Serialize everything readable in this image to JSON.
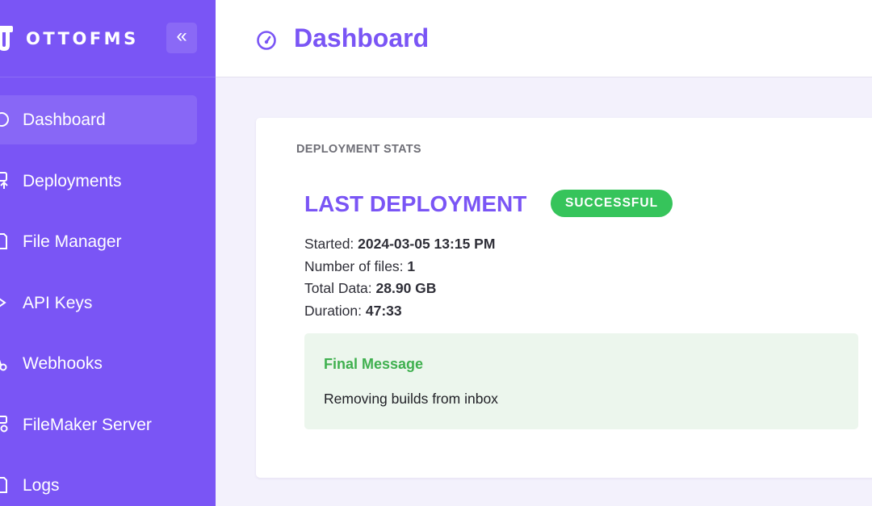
{
  "brand": {
    "name": "OTTOFMS",
    "collapse_label": "«",
    "logo_icon": "ottofms-logo-icon",
    "collapse_icon": "double-chevron-left-icon"
  },
  "sidebar": {
    "items": [
      {
        "label": "Dashboard",
        "icon": "gauge-icon",
        "active": true
      },
      {
        "label": "Deployments",
        "icon": "deploy-icon",
        "active": false
      },
      {
        "label": "File Manager",
        "icon": "folder-icon",
        "active": false
      },
      {
        "label": "API Keys",
        "icon": "key-icon",
        "active": false
      },
      {
        "label": "Webhooks",
        "icon": "webhook-icon",
        "active": false
      },
      {
        "label": "FileMaker Server",
        "icon": "server-icon",
        "active": false
      },
      {
        "label": "Logs",
        "icon": "document-icon",
        "active": false
      }
    ]
  },
  "header": {
    "title": "Dashboard",
    "icon": "gauge-icon"
  },
  "deployment_stats": {
    "heading": "DEPLOYMENT STATS",
    "title": "LAST DEPLOYMENT",
    "status": "SUCCESSFUL",
    "started_label": "Started:",
    "started_value": "2024-03-05 13:15 PM",
    "files_label": "Number of files:",
    "files_value": "1",
    "data_label": "Total Data:",
    "data_value": "28.90 GB",
    "duration_label": "Duration:",
    "duration_value": "47:33",
    "message_title": "Final Message",
    "message_text": "Removing builds from inbox"
  },
  "colors": {
    "brand_purple": "#7a55f5",
    "success_green": "#36c45b",
    "message_bg": "#ecf6ed",
    "message_title": "#3fb04f",
    "page_bg": "#f3f1fc"
  }
}
